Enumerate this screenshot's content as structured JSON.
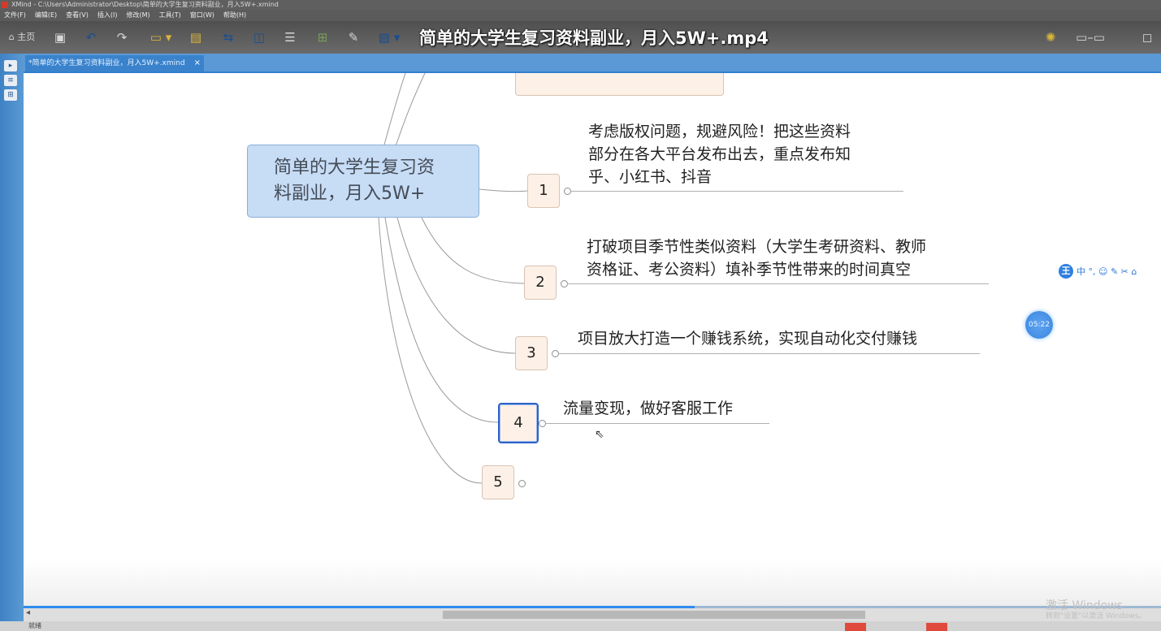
{
  "window": {
    "title": "XMind - C:\\Users\\Administrator\\Desktop\\简单的大学生复习资料副业，月入5W+.xmind",
    "menu": [
      "文件(F)",
      "编辑(E)",
      "查看(V)",
      "插入(I)",
      "修改(M)",
      "工具(T)",
      "窗口(W)",
      "帮助(H)"
    ]
  },
  "toolbar": {
    "home_label": "主页",
    "video_title": "简单的大学生复习资料副业，月入5W+.mp4"
  },
  "tab": {
    "label": "*简单的大学生复习资料副业，月入5W+.xmind",
    "close": "×"
  },
  "mindmap": {
    "central": {
      "line1": "简单的大学生复习资",
      "line2": "料副业，月入5W+"
    },
    "branches": [
      {
        "num": "1",
        "lines": [
          "考虑版权问题，规避风险！把这些资料",
          "部分在各大平台发布出去，重点发布知",
          "乎、小红书、抖音"
        ]
      },
      {
        "num": "2",
        "lines": [
          "打破项目季节性类似资料（大学生考研资料、教师",
          "资格证、考公资料）填补季节性带来的时间真空"
        ]
      },
      {
        "num": "3",
        "lines": [
          "项目放大打造一个赚钱系统，实现自动化交付赚钱"
        ]
      },
      {
        "num": "4",
        "lines": [
          "流量变现，做好客服工作"
        ],
        "selected": true
      },
      {
        "num": "5",
        "lines": []
      }
    ]
  },
  "widgets": {
    "ime": {
      "logo": "王",
      "items": "中 °, ☺ ✎ ✂ ⌂"
    },
    "timer": "05:22"
  },
  "playback": {
    "progress": 0.59
  },
  "watermark": {
    "line1": "激活 Windows",
    "line2": "转到\"设置\"以激活 Windows。"
  },
  "status": {
    "left": "就绪"
  }
}
